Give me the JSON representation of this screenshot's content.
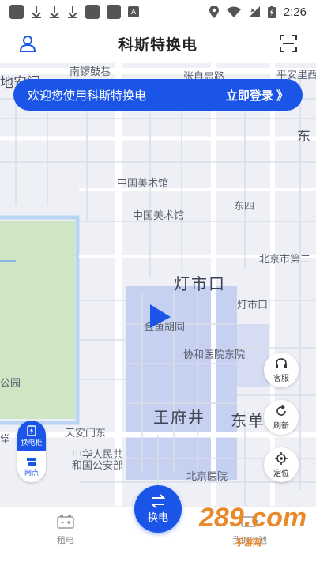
{
  "status_bar": {
    "time": "2:26",
    "notification_badge": "A"
  },
  "header": {
    "title": "科斯特换电",
    "left_icon": "user-icon",
    "right_icon": "scan-icon"
  },
  "banner": {
    "text": "欢迎您使用科斯特换电",
    "login": "立即登录 》"
  },
  "map": {
    "labels": {
      "l1": "南锣鼓巷",
      "l2": "张自忠路",
      "l3": "平安里西",
      "l4": "地安门",
      "l5": "东",
      "l6": "中国美术馆",
      "l7": "中国美术馆",
      "l8": "东四",
      "l9": "北京市第二",
      "l10": "灯市口",
      "l11": "灯市口",
      "l12": "金鱼胡同",
      "l13": "协和医院东院",
      "l14": "公园",
      "l15": "王府井",
      "l16": "东单",
      "l17": "天安门东",
      "l18": "中华人民共",
      "l19": "和国公安部",
      "l20": "北京医院",
      "l21": "堂"
    }
  },
  "right_buttons": {
    "service": "客服",
    "refresh": "刷新",
    "locate": "定位"
  },
  "segment": {
    "cabinet": "换电柜",
    "outlet": "网点"
  },
  "bottom_bar": {
    "rent": "租电",
    "swap": "换电",
    "my_battery": "我的电池"
  },
  "watermark": {
    "logo": "289.com",
    "text": "手游网"
  },
  "colors": {
    "accent": "#1a55e8",
    "map_bg": "#eef0f6",
    "park": "#cfe6c4",
    "block": "#c6d1f1"
  }
}
